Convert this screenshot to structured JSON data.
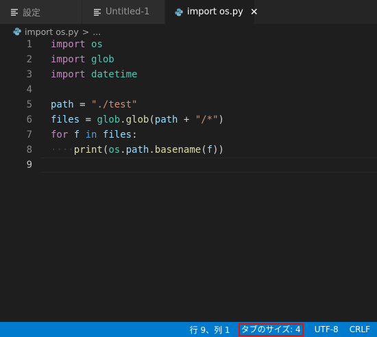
{
  "tabs": [
    {
      "label": "設定",
      "icon": "lines-icon",
      "active": false
    },
    {
      "label": "Untitled-1",
      "icon": "lines-icon",
      "active": false
    },
    {
      "label": "import os.py",
      "icon": "python-icon",
      "active": true,
      "close": "✕"
    }
  ],
  "breadcrumb": {
    "file": "import os.py",
    "separator": ">",
    "more": "..."
  },
  "editor": {
    "current_line": 9,
    "lines": [
      {
        "n": "1",
        "tokens": [
          [
            "kw",
            "import"
          ],
          [
            "plain",
            " "
          ],
          [
            "mod",
            "os"
          ]
        ]
      },
      {
        "n": "2",
        "tokens": [
          [
            "kw",
            "import"
          ],
          [
            "plain",
            " "
          ],
          [
            "mod",
            "glob"
          ]
        ]
      },
      {
        "n": "3",
        "tokens": [
          [
            "kw",
            "import"
          ],
          [
            "plain",
            " "
          ],
          [
            "mod",
            "datetime"
          ]
        ]
      },
      {
        "n": "4",
        "tokens": []
      },
      {
        "n": "5",
        "tokens": [
          [
            "var",
            "path"
          ],
          [
            "plain",
            " = "
          ],
          [
            "str",
            "\"./test\""
          ]
        ]
      },
      {
        "n": "6",
        "tokens": [
          [
            "var",
            "files"
          ],
          [
            "plain",
            " = "
          ],
          [
            "mod",
            "glob"
          ],
          [
            "plain",
            "."
          ],
          [
            "fn",
            "glob"
          ],
          [
            "plain",
            "("
          ],
          [
            "var",
            "path"
          ],
          [
            "plain",
            " + "
          ],
          [
            "str",
            "\"/*\""
          ],
          [
            "plain",
            ")"
          ]
        ]
      },
      {
        "n": "7",
        "tokens": [
          [
            "kw",
            "for"
          ],
          [
            "plain",
            " "
          ],
          [
            "var",
            "f"
          ],
          [
            "plain",
            " "
          ],
          [
            "kw2",
            "in"
          ],
          [
            "plain",
            " "
          ],
          [
            "var",
            "files"
          ],
          [
            "plain",
            ":"
          ]
        ]
      },
      {
        "n": "8",
        "tokens": [
          [
            "ws",
            "····"
          ],
          [
            "fn",
            "print"
          ],
          [
            "plain",
            "("
          ],
          [
            "mod",
            "os"
          ],
          [
            "plain",
            "."
          ],
          [
            "var",
            "path"
          ],
          [
            "plain",
            "."
          ],
          [
            "fn",
            "basename"
          ],
          [
            "plain",
            "("
          ],
          [
            "var",
            "f"
          ],
          [
            "plain",
            "))"
          ]
        ]
      },
      {
        "n": "9",
        "tokens": []
      }
    ]
  },
  "statusbar": {
    "position": "行 9、列 1",
    "tab_size": "タブのサイズ: 4",
    "encoding": "UTF-8",
    "eol": "CRLF"
  },
  "colors": {
    "statusbar": "#007acc",
    "highlight_border": "#e51400",
    "editor_bg": "#1e1e1e"
  }
}
